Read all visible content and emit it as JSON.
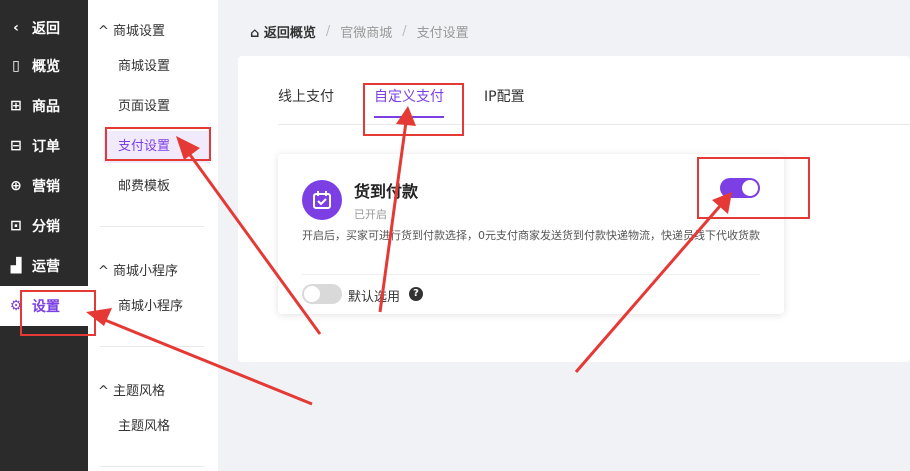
{
  "nav": {
    "back": "返回",
    "items": [
      "概览",
      "商品",
      "订单",
      "营销",
      "分销",
      "运营",
      "设置"
    ]
  },
  "subnav": {
    "groups": [
      {
        "title": "商城设置",
        "items": [
          "商城设置",
          "页面设置",
          "支付设置",
          "邮费模板"
        ]
      },
      {
        "title": "商城小程序",
        "items": [
          "商城小程序"
        ]
      },
      {
        "title": "主题风格",
        "items": [
          "主题风格"
        ]
      }
    ]
  },
  "breadcrumb": {
    "home": "返回概览",
    "path": [
      "官微商城",
      "支付设置"
    ]
  },
  "tabs": [
    "线上支付",
    "自定义支付",
    "IP配置"
  ],
  "payment": {
    "title": "货到付款",
    "status": "已开启",
    "description": "开启后，买家可进行货到付款选择，0元支付商家发送货到付款快递物流，快递员线下代收货款",
    "enabled": true,
    "default_label": "默认选用",
    "default_enabled": false,
    "help": "?"
  },
  "icons": {
    "back": "chevron-left-icon",
    "overview": "book-icon",
    "goods": "grid-icon",
    "orders": "order-icon",
    "marketing": "target-icon",
    "distribution": "share-icon",
    "operation": "bar-chart-icon",
    "settings": "gear-icon",
    "home": "home-icon"
  },
  "colors": {
    "accent": "#7b3fe4",
    "annotation": "#e53935",
    "sidebar": "#2b2b2b"
  }
}
